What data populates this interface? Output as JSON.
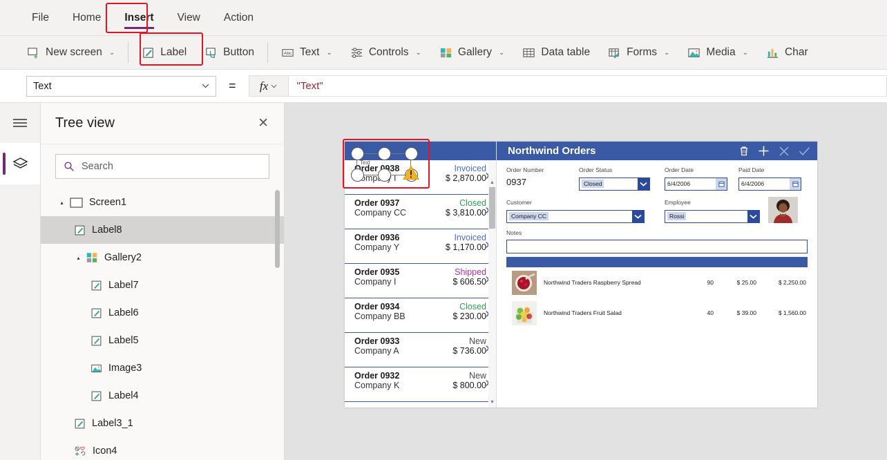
{
  "menu": {
    "items": [
      {
        "label": "File",
        "active": false
      },
      {
        "label": "Home",
        "active": false
      },
      {
        "label": "Insert",
        "active": true
      },
      {
        "label": "View",
        "active": false
      },
      {
        "label": "Action",
        "active": false
      }
    ]
  },
  "ribbon": {
    "items": [
      {
        "label": "New screen",
        "icon": "new-screen-icon",
        "chevron": "⌄",
        "highlighted": false
      },
      {
        "label": "Label",
        "icon": "label-icon",
        "chevron": "",
        "highlighted": true
      },
      {
        "label": "Button",
        "icon": "button-icon",
        "chevron": "",
        "highlighted": false
      },
      {
        "label": "Text",
        "icon": "text-abc-icon",
        "chevron": "⌄",
        "highlighted": false
      },
      {
        "label": "Controls",
        "icon": "controls-sliders-icon",
        "chevron": "⌄",
        "highlighted": false
      },
      {
        "label": "Gallery",
        "icon": "gallery-grid-icon",
        "chevron": "⌄",
        "highlighted": false
      },
      {
        "label": "Data table",
        "icon": "data-table-icon",
        "chevron": "",
        "highlighted": false
      },
      {
        "label": "Forms",
        "icon": "forms-icon",
        "chevron": "⌄",
        "highlighted": false
      },
      {
        "label": "Media",
        "icon": "media-image-icon",
        "chevron": "⌄",
        "highlighted": false
      },
      {
        "label": "Char",
        "icon": "charts-bar-icon",
        "chevron": "",
        "highlighted": false
      }
    ]
  },
  "formula_bar": {
    "property": "Text",
    "equals": "=",
    "fx_label": "fx",
    "value": "\"Text\""
  },
  "tree_panel": {
    "title": "Tree view",
    "close_label": "✕",
    "search_placeholder": "Search",
    "nodes": [
      {
        "label": "Screen1",
        "icon": "screen-icon",
        "indent": 0,
        "caret": "▴",
        "selected": false
      },
      {
        "label": "Label8",
        "icon": "label-icon",
        "indent": 1,
        "caret": "",
        "selected": true
      },
      {
        "label": "Gallery2",
        "icon": "gallery-icon",
        "indent": 1,
        "caret": "▴",
        "selected": false
      },
      {
        "label": "Label7",
        "icon": "label-icon",
        "indent": 2,
        "caret": "",
        "selected": false
      },
      {
        "label": "Label6",
        "icon": "label-icon",
        "indent": 2,
        "caret": "",
        "selected": false
      },
      {
        "label": "Label5",
        "icon": "label-icon",
        "indent": 2,
        "caret": "",
        "selected": false
      },
      {
        "label": "Image3",
        "icon": "image-icon",
        "indent": 2,
        "caret": "",
        "selected": false
      },
      {
        "label": "Label4",
        "icon": "label-icon",
        "indent": 2,
        "caret": "",
        "selected": false
      },
      {
        "label": "Label3_1",
        "icon": "label-icon",
        "indent": 1,
        "caret": "",
        "selected": false
      },
      {
        "label": "Icon4",
        "icon": "icon-set-icon",
        "indent": 1,
        "caret": "",
        "selected": false
      }
    ]
  },
  "canvas": {
    "gallery": {
      "rows": [
        {
          "order": "Order 0938",
          "company": "Company I",
          "status": "Invoiced",
          "status_color": "#4f6bd8",
          "amount": "$ 2,870.00"
        },
        {
          "order": "Order 0937",
          "company": "Company CC",
          "status": "Closed",
          "status_color": "#2e9e4f",
          "amount": "$ 3,810.00"
        },
        {
          "order": "Order 0936",
          "company": "Company Y",
          "status": "Invoiced",
          "status_color": "#4f6bd8",
          "amount": "$ 1,170.00"
        },
        {
          "order": "Order 0935",
          "company": "Company I",
          "status": "Shipped",
          "status_color": "#b4309b",
          "amount": "$ 606.50"
        },
        {
          "order": "Order 0934",
          "company": "Company BB",
          "status": "Closed",
          "status_color": "#2e9e4f",
          "amount": "$ 230.00"
        },
        {
          "order": "Order 0933",
          "company": "Company A",
          "status": "New",
          "status_color": "#4a4a4a",
          "amount": "$ 736.00"
        },
        {
          "order": "Order 0932",
          "company": "Company K",
          "status": "New",
          "status_color": "#4a4a4a",
          "amount": "$ 800.00"
        }
      ],
      "chevron": "›"
    },
    "detail": {
      "title": "Northwind Orders",
      "actions": [
        "trash-icon",
        "plus-icon",
        "cancel-x-icon",
        "confirm-check-icon"
      ],
      "fields": {
        "order_number_label": "Order Number",
        "order_number_value": "0937",
        "order_status_label": "Order Status",
        "order_status_value": "Closed",
        "order_date_label": "Order Date",
        "order_date_value": "6/4/2006",
        "paid_date_label": "Paid Date",
        "paid_date_value": "6/4/2006",
        "customer_label": "Customer",
        "customer_value": "Company CC",
        "employee_label": "Employee",
        "employee_value": "Rossi",
        "notes_label": "Notes",
        "notes_value": ""
      },
      "line_items": [
        {
          "name": "Northwind Traders Raspberry Spread",
          "qty": "90",
          "price": "$ 25.00",
          "total": "$ 2,250.00"
        },
        {
          "name": "Northwind Traders Fruit Salad",
          "qty": "40",
          "price": "$ 39.00",
          "total": "$ 1,560.00"
        }
      ]
    },
    "selection": {
      "control_label": "Text",
      "warning": "warning-triangle-icon"
    }
  },
  "colors": {
    "accent_purple": "#742774",
    "app_blue": "#3b5aa6",
    "highlight_red": "#e81123",
    "formula_red": "#a4262c"
  }
}
